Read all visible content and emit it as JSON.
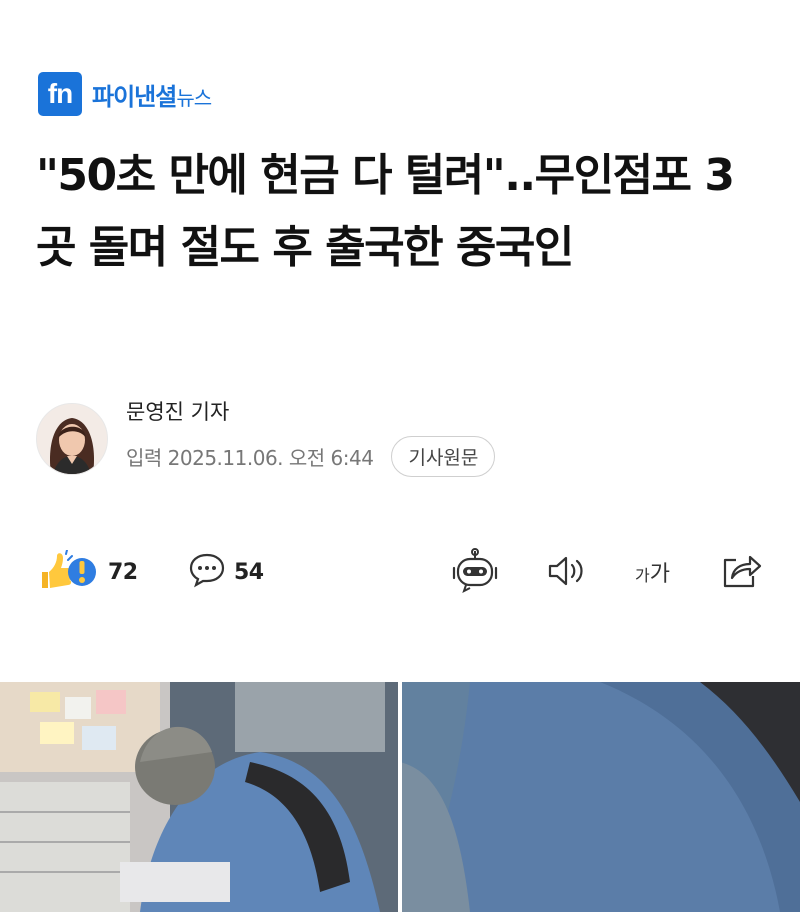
{
  "publisher": {
    "logo_text": "fn",
    "name": "파이낸셜",
    "name_suffix": "뉴스",
    "brand_color": "#1a73d9"
  },
  "article": {
    "headline": "\"50초 만에 현금 다 털려\"..무인점포 3곳 돌며 절도 후 출국한 중국인",
    "reporter": "문영진 기자",
    "published": "입력 2025.11.06. 오전 6:44",
    "original_button": "기사원문"
  },
  "actions": {
    "reactions_count": "72",
    "comments_count": "54",
    "font_size_label": "가가",
    "icons": [
      "reaction-emoji-icon",
      "speech-bubble-icon",
      "robot-summary-icon",
      "speaker-icon",
      "font-size-icon",
      "share-icon"
    ]
  }
}
